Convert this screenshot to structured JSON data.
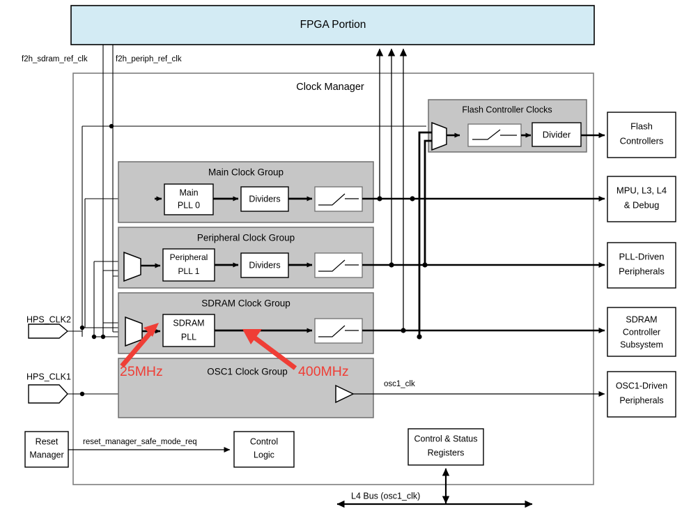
{
  "figure": {
    "title_blocks": {
      "fpga": "FPGA Portion",
      "clock_manager": "Clock Manager"
    }
  },
  "fpga_block": {
    "label": "FPGA Portion",
    "fill": "#d3ebf4",
    "stroke": "#000000"
  },
  "clock_manager": {
    "label": "Clock Manager",
    "stroke": "#7d7d7d"
  },
  "fpga_signals": [
    {
      "name": "f2h_sdram_ref_clk"
    },
    {
      "name": "f2h_periph_ref_clk"
    }
  ],
  "clock_groups": [
    {
      "id": "flash-controller-clocks",
      "label": "Flash Controller Clocks",
      "fill": "#c6c6c6",
      "blocks": [
        {
          "id": "flash-mux",
          "type": "mux",
          "label": ""
        },
        {
          "id": "flash-gate",
          "type": "switch",
          "label": ""
        },
        {
          "id": "flash-divider",
          "type": "box",
          "label": "Divider"
        }
      ]
    },
    {
      "id": "main-clock-group",
      "label": "Main Clock Group",
      "fill": "#c6c6c6",
      "blocks": [
        {
          "id": "main-pll",
          "type": "box",
          "label": "Main\nPLL 0",
          "line1": "Main",
          "line2": "PLL 0"
        },
        {
          "id": "main-dividers",
          "type": "box",
          "label": "Dividers"
        },
        {
          "id": "main-gate",
          "type": "switch",
          "label": ""
        }
      ]
    },
    {
      "id": "peripheral-clock-group",
      "label": "Peripheral Clock Group",
      "fill": "#c6c6c6",
      "blocks": [
        {
          "id": "periph-mux",
          "type": "mux",
          "label": ""
        },
        {
          "id": "periph-pll",
          "type": "box",
          "label": "Peripheral\nPLL 1",
          "line1": "Peripheral",
          "line2": "PLL 1"
        },
        {
          "id": "periph-dividers",
          "type": "box",
          "label": "Dividers"
        },
        {
          "id": "periph-gate",
          "type": "switch",
          "label": ""
        }
      ]
    },
    {
      "id": "sdram-clock-group",
      "label": "SDRAM Clock Group",
      "fill": "#c6c6c6",
      "blocks": [
        {
          "id": "sdram-mux",
          "type": "mux",
          "label": ""
        },
        {
          "id": "sdram-pll",
          "type": "box",
          "label": "SDRAM\nPLL",
          "line1": "SDRAM",
          "line2": "PLL"
        },
        {
          "id": "sdram-gate",
          "type": "switch",
          "label": ""
        }
      ]
    },
    {
      "id": "osc1-clock-group",
      "label": "OSC1 Clock Group",
      "fill": "#c6c6c6",
      "blocks": [
        {
          "id": "osc1-buffer",
          "type": "buffer",
          "label": ""
        }
      ]
    }
  ],
  "inputs": [
    {
      "id": "hps-clk2",
      "label": "HPS_CLK2"
    },
    {
      "id": "hps-clk1",
      "label": "HPS_CLK1"
    }
  ],
  "outputs": [
    {
      "id": "flash-controllers",
      "lines": [
        "Flash",
        "Controllers"
      ]
    },
    {
      "id": "mpu-l3-l4-debug",
      "lines": [
        "MPU, L3, L4",
        "& Debug"
      ]
    },
    {
      "id": "pll-driven-peripherals",
      "lines": [
        "PLL-Driven",
        "Peripherals"
      ]
    },
    {
      "id": "sdram-controller-subsystem",
      "lines": [
        "SDRAM",
        "Controller",
        "Subsystem"
      ]
    },
    {
      "id": "osc1-driven-peripherals",
      "lines": [
        "OSC1-Driven",
        "Peripherals"
      ]
    }
  ],
  "bottom": {
    "reset_manager": {
      "lines": [
        "Reset",
        "Manager"
      ]
    },
    "reset_signal": "reset_manager_safe_mode_req",
    "control_logic": {
      "lines": [
        "Control",
        "Logic"
      ]
    },
    "csr": {
      "lines": [
        "Control & Status",
        "Registers"
      ]
    },
    "l4_bus": "L4 Bus (osc1_clk)"
  },
  "net_labels": [
    {
      "id": "osc1-clk",
      "text": "osc1_clk"
    }
  ],
  "annotations": [
    {
      "id": "ann-25mhz",
      "text": "25MHz",
      "color": "#ef3e36"
    },
    {
      "id": "ann-400mhz",
      "text": "400MHz",
      "color": "#ef3e36"
    }
  ],
  "colors": {
    "fpga_fill": "#d3ebf4",
    "group_fill": "#c6c6c6",
    "group_stroke": "#6f6f6f",
    "wire": "#000000",
    "annotation_red": "#ef3e36",
    "manager_stroke": "#7d7d7d"
  }
}
